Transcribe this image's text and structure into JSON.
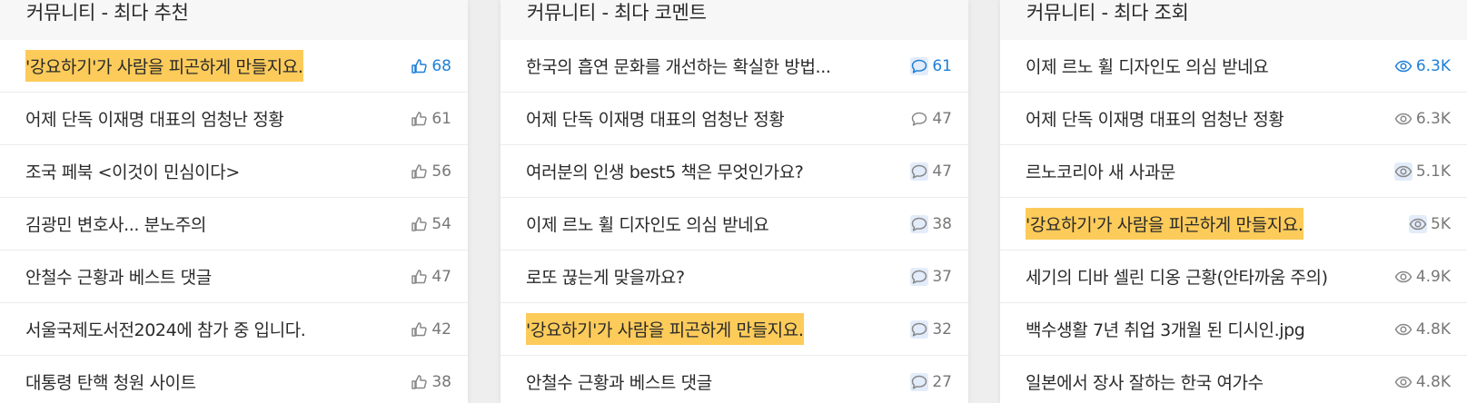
{
  "panels": [
    {
      "title": "커뮤니티 - 최다 추천",
      "icon": "thumbs-up-icon",
      "items": [
        {
          "text": "'강요하기'가 사람을 피곤하게 만들지요.",
          "count": "68",
          "highlight": true,
          "active": true
        },
        {
          "text": "어제 단독 이재명 대표의 엄청난 정황",
          "count": "61",
          "highlight": false,
          "active": false
        },
        {
          "text": "조국 페북 <이것이 민심이다>",
          "count": "56",
          "highlight": false,
          "active": false
        },
        {
          "text": "김광민 변호사... 분노주의",
          "count": "54",
          "highlight": false,
          "active": false
        },
        {
          "text": "안철수 근황과 베스트 댓글",
          "count": "47",
          "highlight": false,
          "active": false
        },
        {
          "text": "서울국제도서전2024에 참가 중 입니다.",
          "count": "42",
          "highlight": false,
          "active": false
        },
        {
          "text": "대통령 탄핵 청원 사이트",
          "count": "38",
          "highlight": false,
          "active": false
        }
      ]
    },
    {
      "title": "커뮤니티 - 최다 코멘트",
      "icon": "comment-icon",
      "items": [
        {
          "text": "한국의 흡연 문화를 개선하는 확실한 방법...",
          "count": "61",
          "highlight": false,
          "active": true
        },
        {
          "text": "어제 단독 이재명 대표의 엄청난 정황",
          "count": "47",
          "highlight": false,
          "active": false
        },
        {
          "text": "여러분의 인생 best5 책은 무엇인가요?",
          "count": "47",
          "highlight": false,
          "active": false
        },
        {
          "text": "이제 르노 휠 디자인도 의심 받네요",
          "count": "38",
          "highlight": false,
          "active": false
        },
        {
          "text": "로또 끊는게 맞을까요?",
          "count": "37",
          "highlight": false,
          "active": false
        },
        {
          "text": "'강요하기'가 사람을 피곤하게 만들지요.",
          "count": "32",
          "highlight": true,
          "active": false
        },
        {
          "text": "안철수 근황과 베스트 댓글",
          "count": "27",
          "highlight": false,
          "active": false
        }
      ]
    },
    {
      "title": "커뮤니티 - 최다 조회",
      "icon": "eye-icon",
      "items": [
        {
          "text": "이제 르노 휠 디자인도 의심 받네요",
          "count": "6.3K",
          "highlight": false,
          "active": true
        },
        {
          "text": "어제 단독 이재명 대표의 엄청난 정황",
          "count": "6.3K",
          "highlight": false,
          "active": false
        },
        {
          "text": "르노코리아 새 사과문",
          "count": "5.1K",
          "highlight": false,
          "active": false
        },
        {
          "text": "'강요하기'가 사람을 피곤하게 만들지요.",
          "count": "5K",
          "highlight": true,
          "active": false
        },
        {
          "text": "세기의 디바 셀린 디옹 근황(안타까움 주의)",
          "count": "4.9K",
          "highlight": false,
          "active": false
        },
        {
          "text": "백수생활 7년 취업 3개월 된 디시인.jpg",
          "count": "4.8K",
          "highlight": false,
          "active": false
        },
        {
          "text": "일본에서 장사 잘하는 한국 여가수",
          "count": "4.8K",
          "highlight": false,
          "active": false
        }
      ]
    }
  ],
  "colors": {
    "accent": "#1e7fd8",
    "highlight": "#fccb5a",
    "muted": "#777777"
  }
}
